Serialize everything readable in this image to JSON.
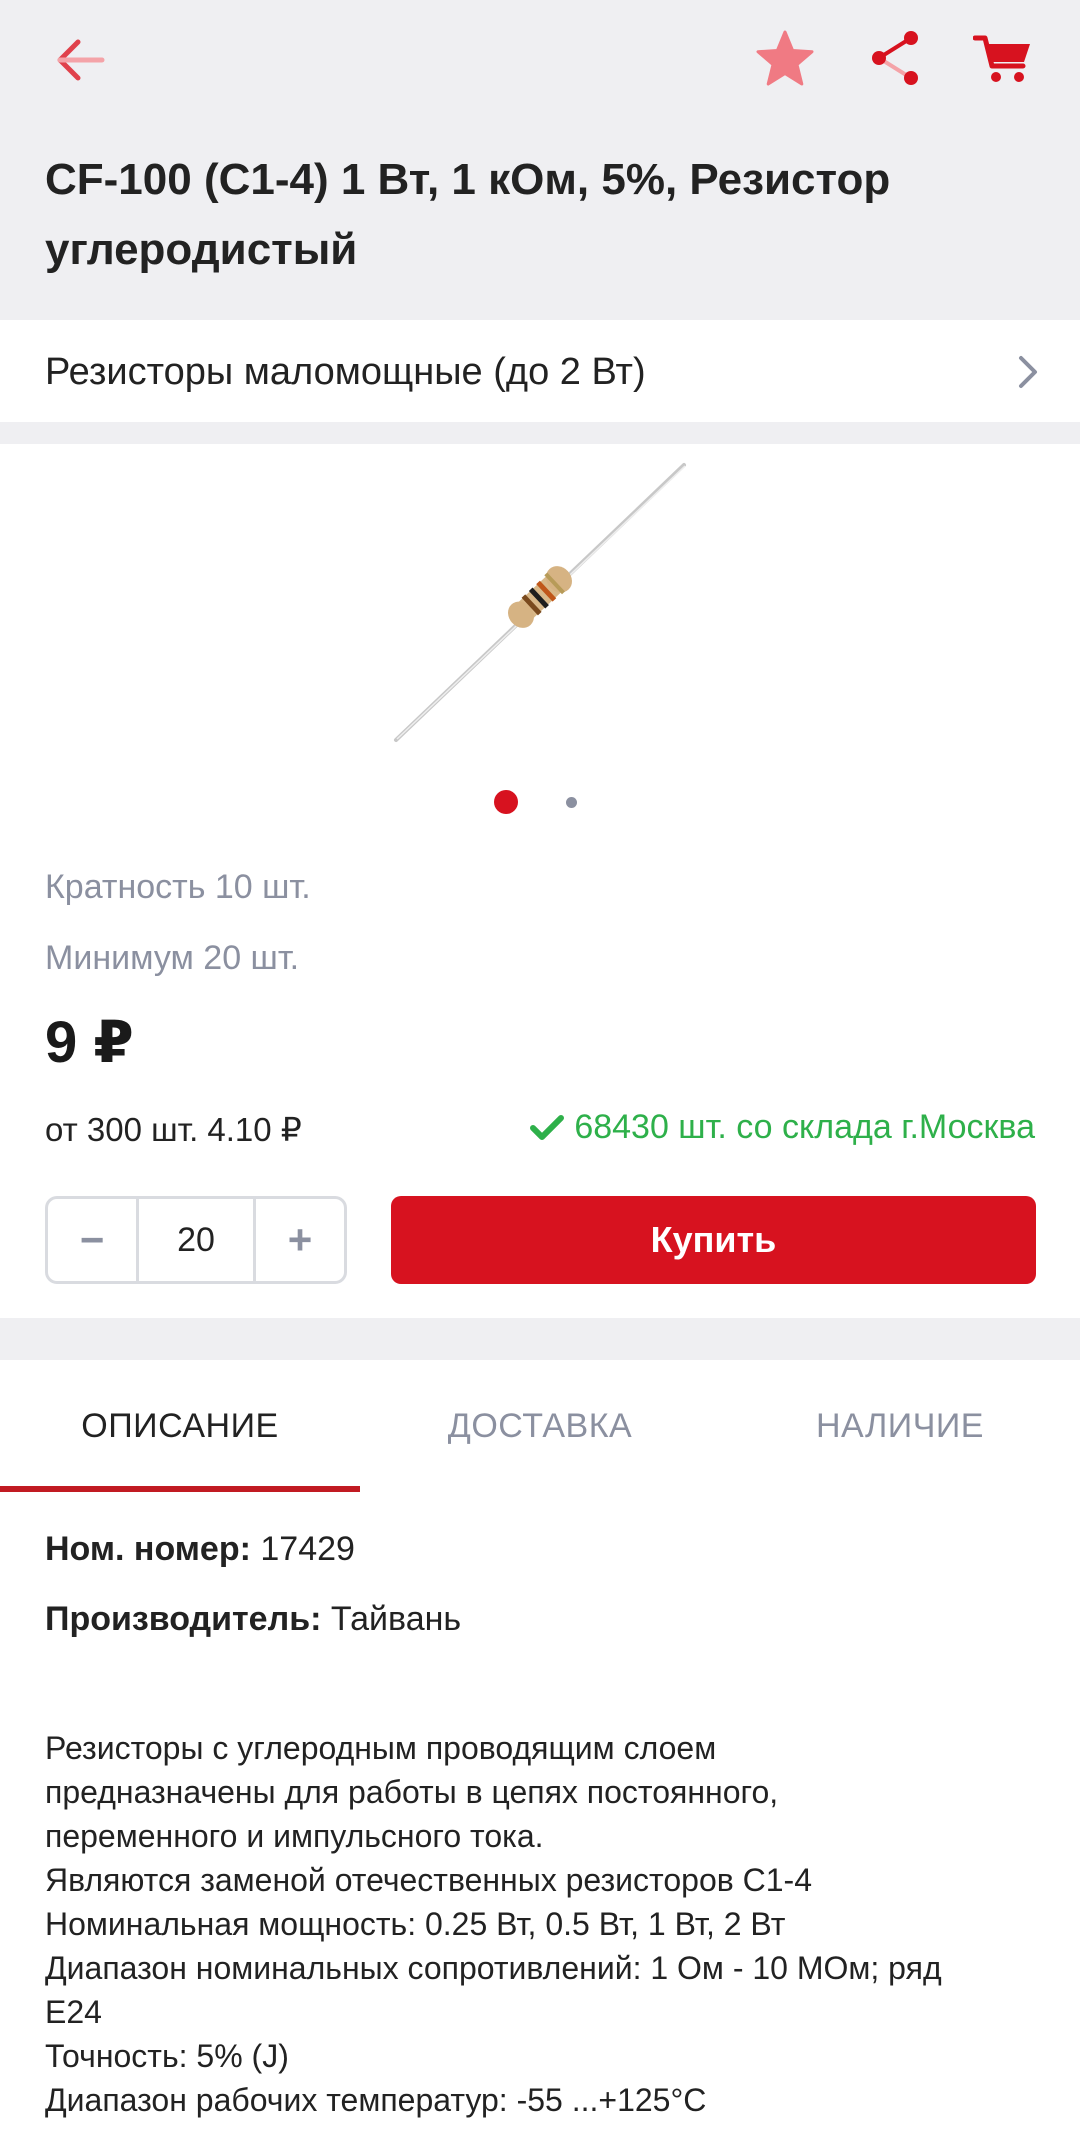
{
  "header": {
    "title": "CF-100 (С1-4) 1 Вт, 1 кОм, 5%, Резистор углеродистый",
    "back_icon": "arrow-left-icon",
    "favorite_icon": "star-icon",
    "share_icon": "share-icon",
    "cart_icon": "cart-icon"
  },
  "category": {
    "label": "Резисторы маломощные (до 2 Вт)"
  },
  "gallery": {
    "slides_count": 2,
    "active_index": 0
  },
  "product": {
    "multiplicity": "Кратность 10 шт.",
    "minimum": "Минимум 20 шт.",
    "price": "9 ₽",
    "bulk_price": "от 300 шт. 4.10 ₽",
    "stock": "68430 шт. со склада г.Москва"
  },
  "quantity": {
    "minus": "−",
    "value": "20",
    "plus": "+"
  },
  "buy": {
    "label": "Купить"
  },
  "tabs": [
    {
      "label": "ОПИСАНИЕ"
    },
    {
      "label": "ДОСТАВКА"
    },
    {
      "label": "НАЛИЧИЕ"
    }
  ],
  "specs": {
    "number_label": "Ном. номер:",
    "number_value": " 17429",
    "maker_label": "Производитель:",
    "maker_value": " Тайвань"
  },
  "description": [
    "Резисторы с углеродным проводящим слоем",
    "предназначены для работы в цепях постоянного,",
    "переменного и импульсного тока.",
    "Являются заменой отечественных резисторов С1-4",
    "Номинальная мощность: 0.25 Вт, 0.5 Вт, 1 Вт, 2 Вт",
    "Диапазон номинальных сопротивлений: 1 Ом - 10 МОм; ряд",
    "E24",
    "Точность: 5% (J)",
    "Диапазон рабочих температур: -55 ...+125°C"
  ],
  "colors": {
    "accent": "#d7121f",
    "stock_green": "#2eb04a",
    "muted": "#8b90a0",
    "header_bg": "#efeff2"
  }
}
